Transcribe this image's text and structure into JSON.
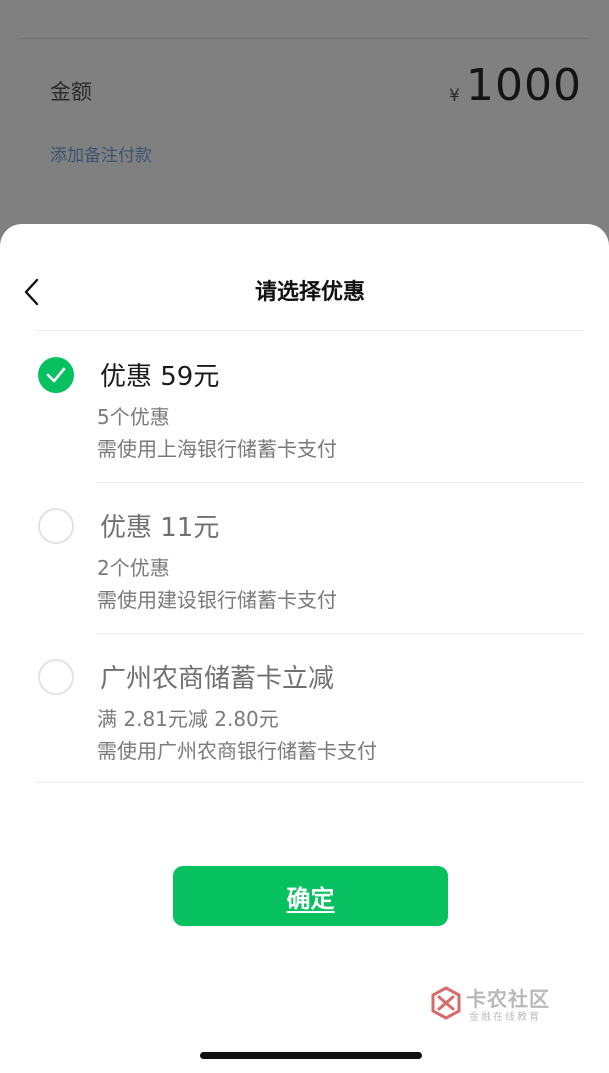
{
  "background": {
    "amount_label": "金额",
    "currency_symbol": "¥",
    "amount_value": "1000",
    "add_remark_link": "添加备注付款"
  },
  "sheet": {
    "title": "请选择优惠",
    "options": [
      {
        "title": "优惠 59元",
        "detail": "5个优惠",
        "requirement": "需使用上海银行储蓄卡支付",
        "selected": true
      },
      {
        "title": "优惠 11元",
        "detail": "2个优惠",
        "requirement": "需使用建设银行储蓄卡支付",
        "selected": false
      },
      {
        "title": "广州农商储蓄卡立减",
        "detail": "满 2.81元减 2.80元",
        "requirement": "需使用广州农商银行储蓄卡支付",
        "selected": false
      }
    ],
    "confirm_label": "确定"
  },
  "watermark": {
    "name": "卡农社区",
    "tagline": "金融在线教育"
  },
  "colors": {
    "accent": "#07c160",
    "overlay": "#808080",
    "link": "#3d5470"
  },
  "icons": {
    "back": "chevron-left-icon",
    "check": "checkmark-icon"
  }
}
